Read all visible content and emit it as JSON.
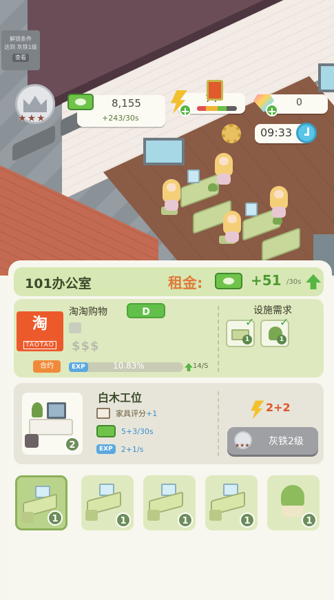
{
  "scene": {
    "sign": {
      "line1": "解锁条件",
      "line2": "达到 灰铁1级",
      "tag": "查看"
    }
  },
  "hud": {
    "rank": {
      "icon": "crown-icon",
      "stars": 3
    },
    "cash": {
      "value": "8,155",
      "rate": "+243/30s",
      "icon": "cash-icon"
    },
    "energy": {
      "value": "74",
      "icon": "lightning-icon",
      "level": 0.74
    },
    "gems": {
      "value": "0",
      "icon": "gem-icon"
    },
    "clock": {
      "value": "09:33",
      "icon": "alarm-clock-icon"
    },
    "settings_icon": "gear-icon"
  },
  "room": {
    "title": "101办公室",
    "rent_label": "租金:",
    "rent_amount": "+51",
    "rent_unit": "/30s"
  },
  "tenant": {
    "logo_main": "淘",
    "logo_sub": "TAOTAO",
    "name": "淘淘购物",
    "grade": "D",
    "price_level": "$$$",
    "contract_label": "合约",
    "exp_label": "EXP",
    "exp_percent": "10.83%",
    "exp_fraction": 0.1083,
    "exp_rate": "14/S"
  },
  "facilities": {
    "title": "设施需求",
    "items": [
      {
        "icon": "desk-icon",
        "count": "1"
      },
      {
        "icon": "plant-icon",
        "count": "1"
      }
    ]
  },
  "furniture": {
    "name": "白木工位",
    "level": "2",
    "rating_label": "家具评分",
    "rating_value": "+1",
    "income": "5+3/30s",
    "exp_label": "EXP",
    "exp": "2+1/s",
    "cost": "2+2",
    "unlock_label": "灰铁2级"
  },
  "slots": [
    {
      "type": "desk",
      "level": "1",
      "selected": true
    },
    {
      "type": "desk",
      "level": "1",
      "selected": false
    },
    {
      "type": "desk",
      "level": "1",
      "selected": false
    },
    {
      "type": "desk",
      "level": "1",
      "selected": false
    },
    {
      "type": "plant",
      "level": "1",
      "selected": false
    }
  ],
  "colors": {
    "accent_green": "#56b543",
    "rent_orange": "#e07a3a",
    "panel_bg": "#f7f7ef"
  }
}
